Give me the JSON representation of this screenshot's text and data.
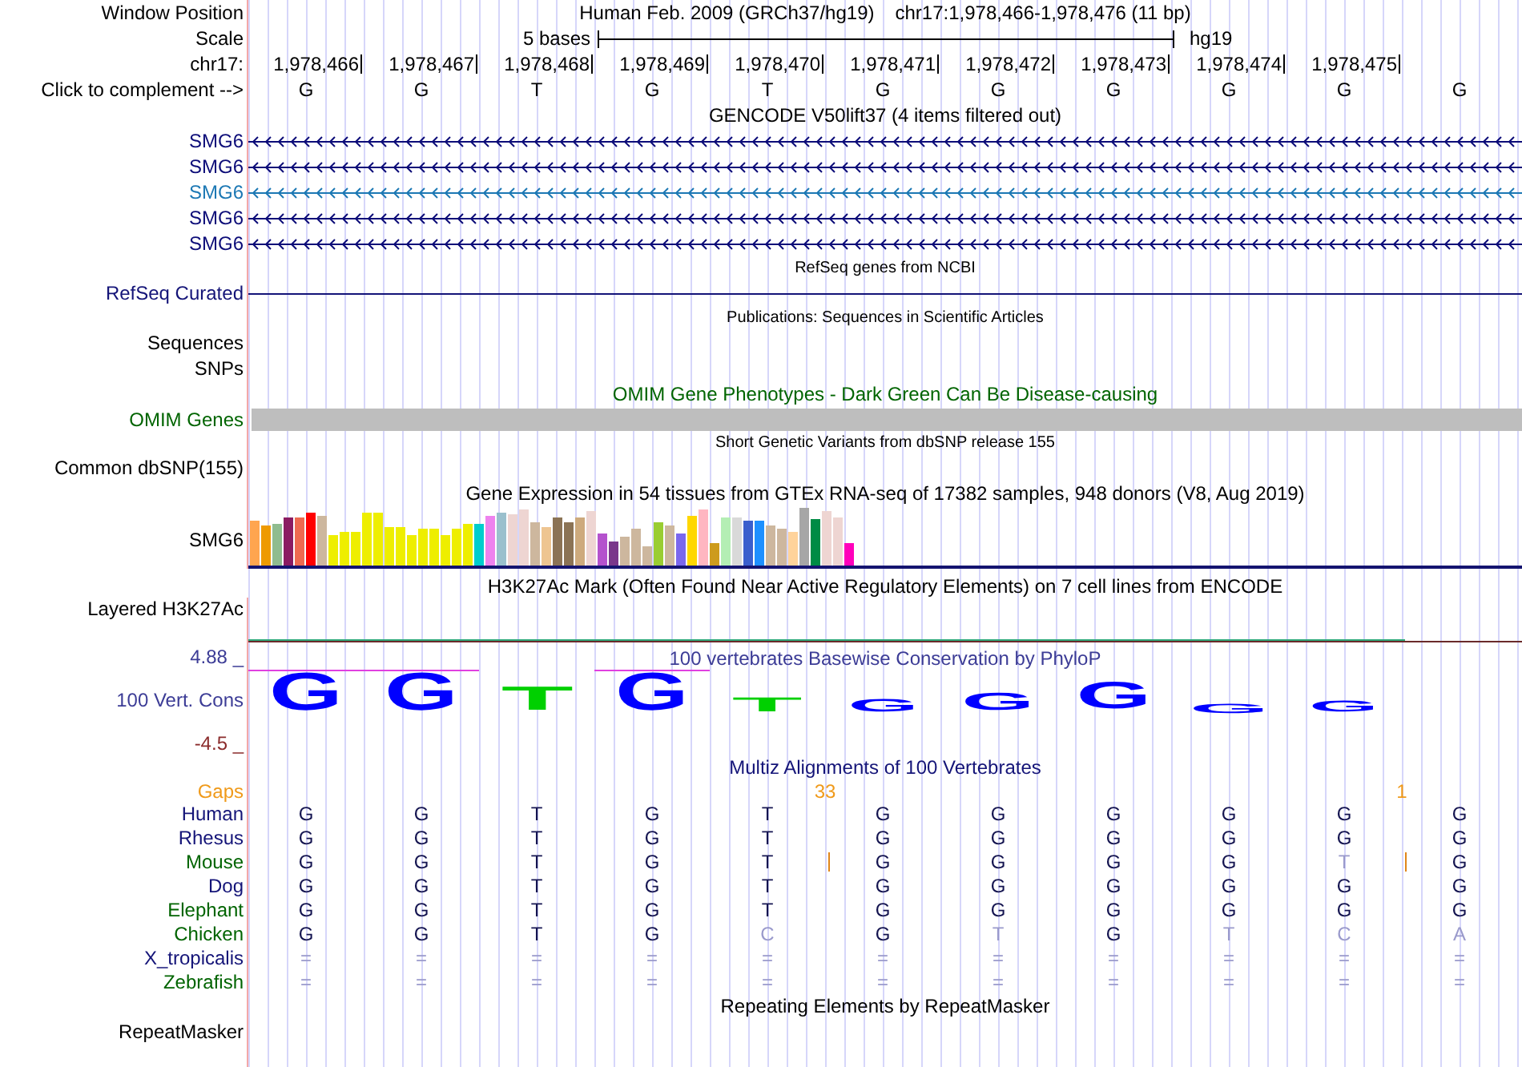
{
  "header": {
    "position_label": "Window Position",
    "assembly": "Human Feb. 2009 (GRCh37/hg19)",
    "position": "chr17:1,978,466-1,978,476 (11 bp)",
    "scale_label": "Scale",
    "scale_text": "5 bases",
    "scale_assembly": "hg19",
    "chrom_label": "chr17:",
    "positions": [
      "1,978,466",
      "1,978,467",
      "1,978,468",
      "1,978,469",
      "1,978,470",
      "1,978,471",
      "1,978,472",
      "1,978,473",
      "1,978,474",
      "1,978,475"
    ],
    "complement_label": "Click to complement -->",
    "bases": [
      "G",
      "G",
      "T",
      "G",
      "T",
      "G",
      "G",
      "G",
      "G",
      "G",
      "G"
    ]
  },
  "tracks": [
    {
      "kind": "genes",
      "title": "GENCODE V50lift37 (4 items filtered out)",
      "items": [
        {
          "name": "SMG6",
          "color": "#0c0c78"
        },
        {
          "name": "SMG6",
          "color": "#0c0c78"
        },
        {
          "name": "SMG6",
          "color": "#1c78b4"
        },
        {
          "name": "SMG6",
          "color": "#0c0c78"
        },
        {
          "name": "SMG6",
          "color": "#0c0c78"
        }
      ]
    },
    {
      "kind": "refseq",
      "title": "RefSeq genes from NCBI",
      "items": [
        {
          "name": "RefSeq Curated"
        }
      ]
    },
    {
      "kind": "publications",
      "title": "Publications: Sequences in Scientific Articles",
      "items": [
        {
          "name": "Sequences"
        },
        {
          "name": "SNPs"
        }
      ]
    },
    {
      "kind": "omim",
      "title": "OMIM Gene Phenotypes - Dark Green Can Be Disease-causing",
      "items": [
        {
          "name": "OMIM Genes"
        }
      ]
    },
    {
      "kind": "variants",
      "title": "Short Genetic Variants from dbSNP release 155",
      "items": [
        {
          "name": "Common dbSNP(155)"
        }
      ]
    },
    {
      "kind": "expression",
      "title": "Gene Expression in 54 tissues from GTEx RNA-seq of 17382 samples, 948 donors (V8, Aug 2019)",
      "label": "SMG6"
    },
    {
      "kind": "signal",
      "title": "H3K27Ac Mark (Often Found Near Active Regulatory Elements) on 7 cell lines from ENCODE",
      "label": "Layered H3K27Ac"
    },
    {
      "kind": "conservation",
      "title": "100 vertebrates Basewise Conservation by PhyloP",
      "label": "100 Vert. Cons",
      "max_label": "4.88 _",
      "min_label": "-4.5 _",
      "logo": [
        {
          "letter": "G",
          "color": "#0000ff",
          "clipped": true
        },
        {
          "letter": "G",
          "color": "#0000ff",
          "clipped": true
        },
        {
          "letter": "T",
          "color": "#00d000",
          "clipped": false
        },
        {
          "letter": "G",
          "color": "#0000ff",
          "clipped": true
        },
        {
          "letter": "T",
          "color": "#00d000",
          "clipped": false
        },
        {
          "letter": "G",
          "color": "#0000ff",
          "clipped": false
        },
        {
          "letter": "G",
          "color": "#0000ff",
          "clipped": false
        },
        {
          "letter": "G",
          "color": "#0000ff",
          "clipped": false
        },
        {
          "letter": "G",
          "color": "#0000ff",
          "clipped": false
        },
        {
          "letter": "G",
          "color": "#0000ff",
          "clipped": false
        }
      ]
    },
    {
      "kind": "alignment",
      "title": "Multiz Alignments of 100 Vertebrates",
      "gaps_label": "Gaps",
      "species": [
        {
          "name": "Human",
          "color": "#141478"
        },
        {
          "name": "Rhesus",
          "color": "#141478"
        },
        {
          "name": "Mouse",
          "color": "#006400"
        },
        {
          "name": "Dog",
          "color": "#141478"
        },
        {
          "name": "Elephant",
          "color": "#006400"
        },
        {
          "name": "Chicken",
          "color": "#006400"
        },
        {
          "name": "X_tropicalis",
          "color": "#141478"
        },
        {
          "name": "Zebrafish",
          "color": "#006400"
        }
      ],
      "columns": [
        {
          "kind": "base",
          "cells": [
            {
              "base": "G",
              "matches": true
            },
            {
              "base": "G",
              "matches": true
            },
            {
              "base": "G",
              "matches": true
            },
            {
              "base": "G",
              "matches": true
            },
            {
              "base": "G",
              "matches": true
            },
            {
              "base": "G",
              "matches": true
            },
            {
              "base": "=",
              "matches": false
            },
            {
              "base": "=",
              "matches": false
            }
          ]
        },
        {
          "kind": "base",
          "cells": [
            {
              "base": "G",
              "matches": true
            },
            {
              "base": "G",
              "matches": true
            },
            {
              "base": "G",
              "matches": true
            },
            {
              "base": "G",
              "matches": true
            },
            {
              "base": "G",
              "matches": true
            },
            {
              "base": "G",
              "matches": true
            },
            {
              "base": "=",
              "matches": false
            },
            {
              "base": "=",
              "matches": false
            }
          ]
        },
        {
          "kind": "base",
          "cells": [
            {
              "base": "T",
              "matches": true
            },
            {
              "base": "T",
              "matches": true
            },
            {
              "base": "T",
              "matches": true
            },
            {
              "base": "T",
              "matches": true
            },
            {
              "base": "T",
              "matches": true
            },
            {
              "base": "T",
              "matches": true
            },
            {
              "base": "=",
              "matches": false
            },
            {
              "base": "=",
              "matches": false
            }
          ]
        },
        {
          "kind": "base",
          "cells": [
            {
              "base": "G",
              "matches": true
            },
            {
              "base": "G",
              "matches": true
            },
            {
              "base": "G",
              "matches": true
            },
            {
              "base": "G",
              "matches": true
            },
            {
              "base": "G",
              "matches": true
            },
            {
              "base": "G",
              "matches": true
            },
            {
              "base": "=",
              "matches": false
            },
            {
              "base": "=",
              "matches": false
            }
          ]
        },
        {
          "kind": "base",
          "cells": [
            {
              "base": "T",
              "matches": true
            },
            {
              "base": "T",
              "matches": true
            },
            {
              "base": "T",
              "matches": true
            },
            {
              "base": "T",
              "matches": true
            },
            {
              "base": "T",
              "matches": true
            },
            {
              "base": "C",
              "matches": false
            },
            {
              "base": "=",
              "matches": false
            },
            {
              "base": "=",
              "matches": false
            }
          ]
        },
        {
          "kind": "insertion",
          "count": "33",
          "marks": [
            false,
            false,
            true,
            false,
            false,
            false,
            false,
            false
          ]
        },
        {
          "kind": "base",
          "cells": [
            {
              "base": "G",
              "matches": true
            },
            {
              "base": "G",
              "matches": true
            },
            {
              "base": "G",
              "matches": true
            },
            {
              "base": "G",
              "matches": true
            },
            {
              "base": "G",
              "matches": true
            },
            {
              "base": "G",
              "matches": true
            },
            {
              "base": "=",
              "matches": false
            },
            {
              "base": "=",
              "matches": false
            }
          ]
        },
        {
          "kind": "base",
          "cells": [
            {
              "base": "G",
              "matches": true
            },
            {
              "base": "G",
              "matches": true
            },
            {
              "base": "G",
              "matches": true
            },
            {
              "base": "G",
              "matches": true
            },
            {
              "base": "G",
              "matches": true
            },
            {
              "base": "T",
              "matches": false
            },
            {
              "base": "=",
              "matches": false
            },
            {
              "base": "=",
              "matches": false
            }
          ]
        },
        {
          "kind": "base",
          "cells": [
            {
              "base": "G",
              "matches": true
            },
            {
              "base": "G",
              "matches": true
            },
            {
              "base": "G",
              "matches": true
            },
            {
              "base": "G",
              "matches": true
            },
            {
              "base": "G",
              "matches": true
            },
            {
              "base": "G",
              "matches": true
            },
            {
              "base": "=",
              "matches": false
            },
            {
              "base": "=",
              "matches": false
            }
          ]
        },
        {
          "kind": "base",
          "cells": [
            {
              "base": "G",
              "matches": true
            },
            {
              "base": "G",
              "matches": true
            },
            {
              "base": "G",
              "matches": true
            },
            {
              "base": "G",
              "matches": true
            },
            {
              "base": "G",
              "matches": true
            },
            {
              "base": "T",
              "matches": false
            },
            {
              "base": "=",
              "matches": false
            },
            {
              "base": "=",
              "matches": false
            }
          ]
        },
        {
          "kind": "base",
          "cells": [
            {
              "base": "G",
              "matches": true
            },
            {
              "base": "G",
              "matches": true
            },
            {
              "base": "T",
              "matches": false
            },
            {
              "base": "G",
              "matches": true
            },
            {
              "base": "G",
              "matches": true
            },
            {
              "base": "C",
              "matches": false
            },
            {
              "base": "=",
              "matches": false
            },
            {
              "base": "=",
              "matches": false
            }
          ]
        },
        {
          "kind": "insertion",
          "count": "1",
          "marks": [
            false,
            false,
            true,
            false,
            false,
            false,
            false,
            false
          ]
        },
        {
          "kind": "base",
          "cells": [
            {
              "base": "G",
              "matches": true
            },
            {
              "base": "G",
              "matches": true
            },
            {
              "base": "G",
              "matches": true
            },
            {
              "base": "G",
              "matches": true
            },
            {
              "base": "G",
              "matches": true
            },
            {
              "base": "A",
              "matches": false
            },
            {
              "base": "=",
              "matches": false
            },
            {
              "base": "=",
              "matches": false
            }
          ]
        }
      ]
    },
    {
      "kind": "repeats",
      "title": "Repeating Elements by RepeatMasker",
      "items": [
        {
          "name": "RepeatMasker"
        }
      ]
    }
  ]
}
